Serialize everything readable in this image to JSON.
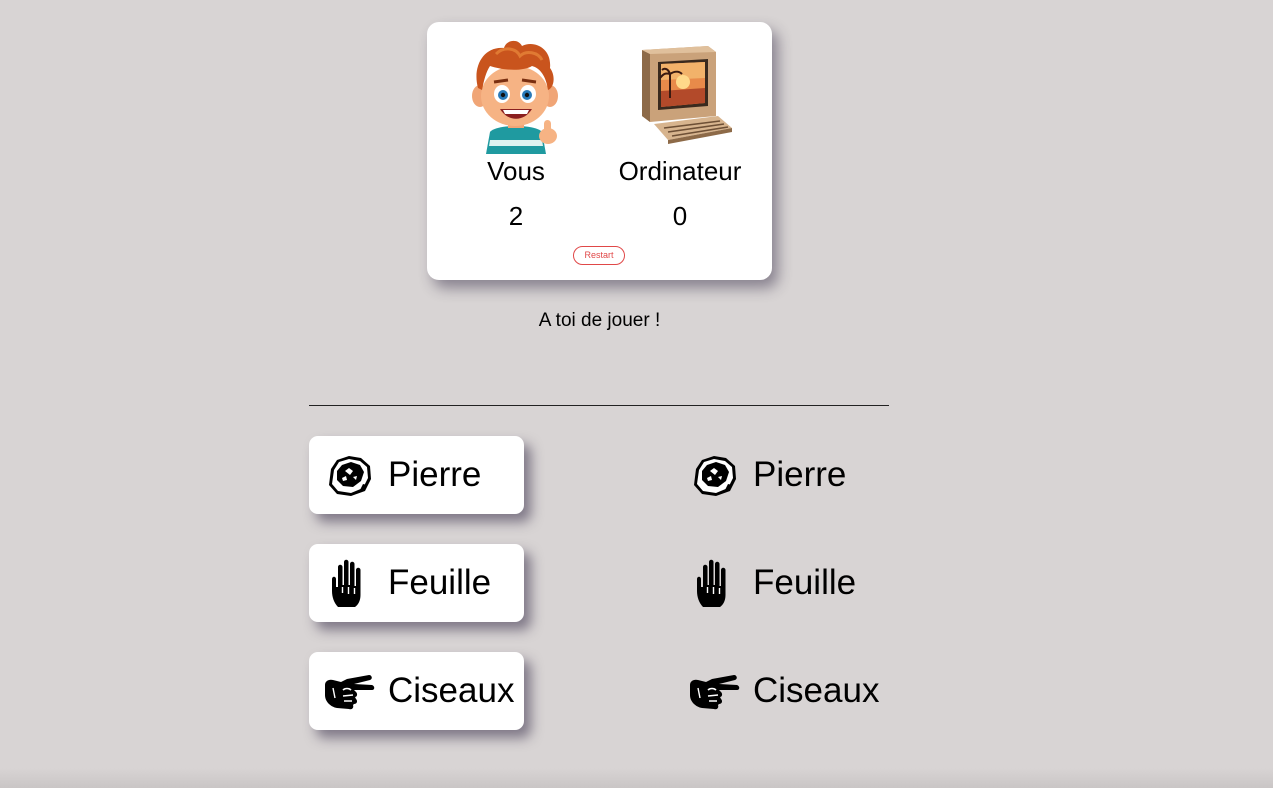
{
  "scoreboard": {
    "you": {
      "name": "Vous",
      "score": "2",
      "avatar_icon": "boy-avatar-icon"
    },
    "cpu": {
      "name": "Ordinateur",
      "score": "0",
      "avatar_icon": "retro-computer-icon"
    },
    "restart_label": "Restart"
  },
  "status": "A toi de jouer !",
  "player_choices": [
    {
      "label": "Pierre",
      "icon": "rock-icon"
    },
    {
      "label": "Feuille",
      "icon": "hand-icon"
    },
    {
      "label": "Ciseaux",
      "icon": "scissors-hand-icon"
    }
  ],
  "computer_choices": [
    {
      "label": "Pierre",
      "icon": "rock-icon"
    },
    {
      "label": "Feuille",
      "icon": "hand-icon"
    },
    {
      "label": "Ciseaux",
      "icon": "scissors-hand-icon"
    }
  ],
  "colors": {
    "background": "#d8d4d4",
    "card": "#ffffff",
    "restart_accent": "#e04848"
  }
}
